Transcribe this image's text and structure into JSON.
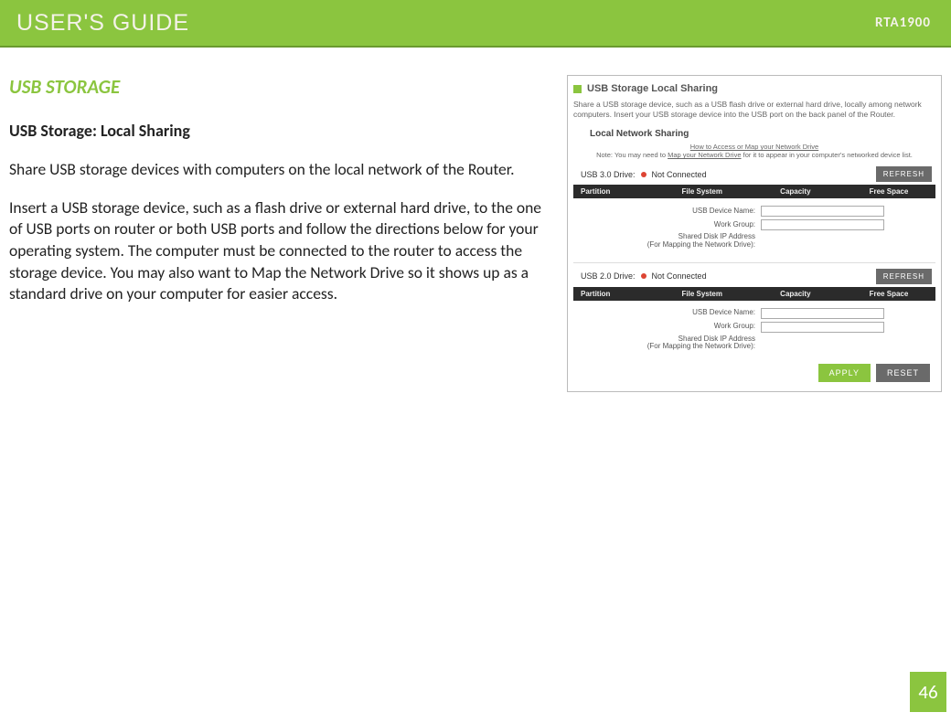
{
  "header": {
    "title": "USER'S GUIDE",
    "model": "RTA1900"
  },
  "section": {
    "title": "USB STORAGE",
    "subtitle": "USB Storage: Local Sharing",
    "para1": "Share USB storage devices with computers on the local network of the Router.",
    "para2": "Insert a USB storage device, such as a flash drive or external hard drive, to the one of USB ports on router or both USB ports and follow the directions below for your operating system.  The computer must be connected to the router to access the storage device.  You may also want to Map the Network Drive so it shows up as a standard drive on your computer for easier access."
  },
  "screenshot": {
    "title": "USB Storage Local Sharing",
    "desc": "Share a USB storage device, such as a USB flash drive or external hard drive, locally among network computers. Insert your USB storage device into the USB port on the back panel of the Router.",
    "local_head": "Local Network Sharing",
    "note_prefix": "Note: You may need to ",
    "note_link1": "How to Access or Map your Network Drive",
    "note_link2": "Map your Network Drive",
    "note_suffix": " for it to appear in your computer's networked device list.",
    "usb30_label": "USB 3.0 Drive:",
    "usb20_label": "USB 2.0 Drive:",
    "not_connected": "Not Connected",
    "refresh": "REFRESH",
    "th_partition": "Partition",
    "th_filesystem": "File System",
    "th_capacity": "Capacity",
    "th_freespace": "Free Space",
    "lbl_device_name": "USB Device Name:",
    "lbl_workgroup": "Work Group:",
    "lbl_ip": "Shared Disk IP Address\n(For Mapping the Network Drive):",
    "apply": "APPLY",
    "reset": "RESET"
  },
  "page_number": "46"
}
